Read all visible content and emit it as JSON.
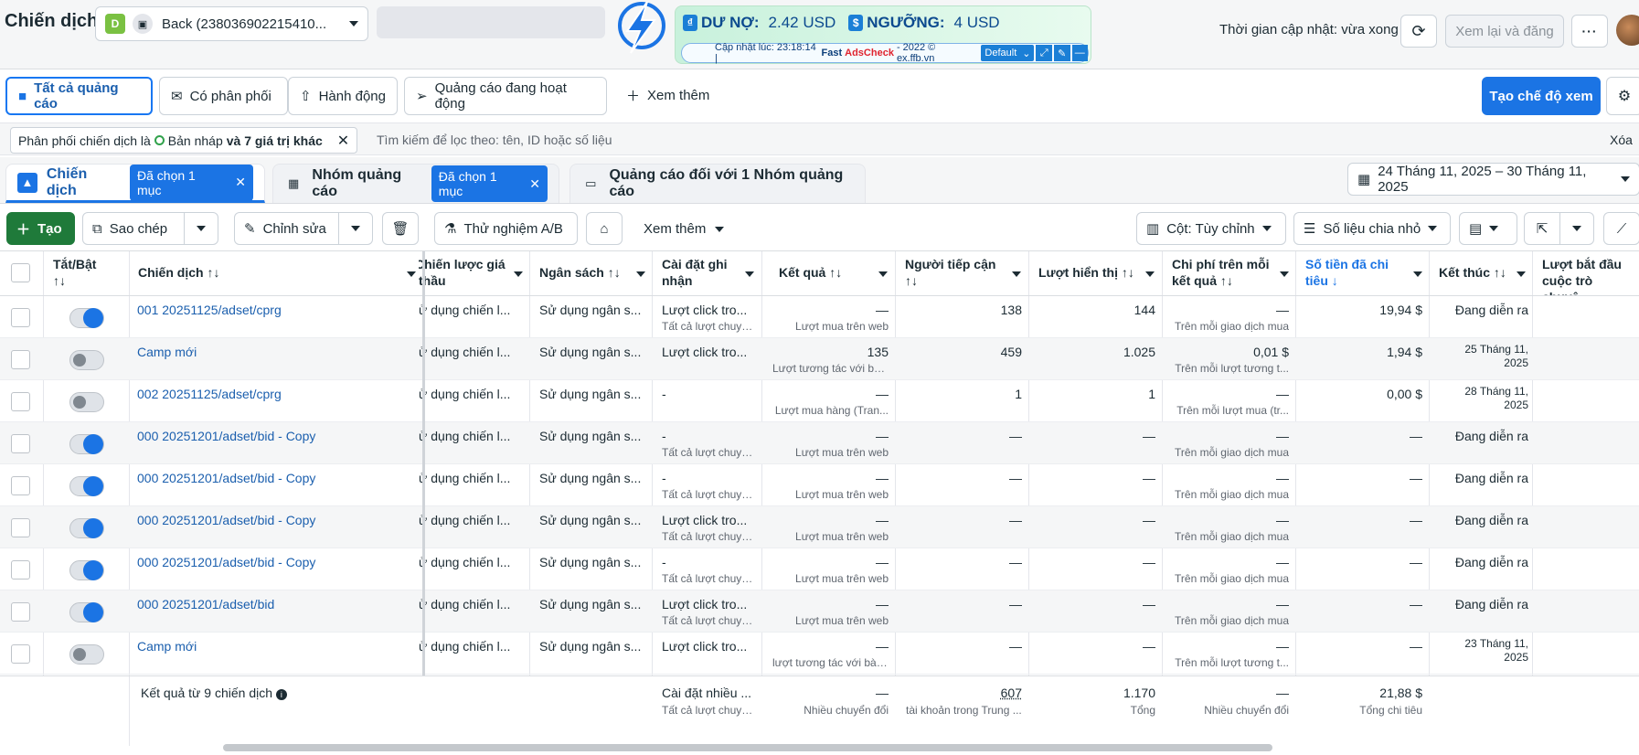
{
  "app_title": "Chiến dịch",
  "account": {
    "initial": "D",
    "name": "Back (238036902215410..."
  },
  "extension": {
    "debt_label": "DƯ NỢ:",
    "debt_value": "2.42 USD",
    "threshold_label": "NGƯỠNG:",
    "threshold_value": "4 USD",
    "update_prefix": "Cập nhật lúc: 23:18:14 |",
    "fast": "Fast",
    "brand": "AdsCheck",
    "suffix": "- 2022 © ex.ffb.vn",
    "profile": "Default"
  },
  "header": {
    "update_text": "Thời gian cập nhật: vừa xong",
    "review_label": "Xem lại và đăng"
  },
  "views": {
    "tabs": [
      "Tất cả quảng cáo",
      "Có phân phối",
      "Hành động",
      "Quảng cáo đang hoạt động"
    ],
    "more": "Xem thêm",
    "create_view": "Tạo chế độ xem"
  },
  "filter": {
    "chip_prefix": "Phân phối chiến dịch là",
    "chip_value": "Bản nháp",
    "chip_suffix": "và 7 giá trị khác",
    "search_placeholder": "Tìm kiếm để lọc theo: tên, ID hoặc số liệu",
    "clear": "Xóa"
  },
  "levels": {
    "campaign": "Chiến dịch",
    "adset": "Nhóm quảng cáo",
    "ad": "Quảng cáo đối với 1 Nhóm quảng cáo",
    "selected": "Đã chọn 1 mục",
    "date_range": "24 Tháng 11, 2025 – 30 Tháng 11, 2025"
  },
  "toolbar": {
    "create": "Tạo",
    "duplicate": "Sao chép",
    "edit": "Chỉnh sửa",
    "ab_test": "Thử nghiệm A/B",
    "more": "Xem thêm",
    "columns": "Cột: Tùy chỉnh",
    "breakdown": "Số liệu chia nhỏ"
  },
  "columns": {
    "toggle": "Tắt/Bật",
    "name": "Chiến dịch",
    "bid": "Chiến lược giá thầu",
    "budget": "Ngân sách",
    "attribution": "Cài đặt ghi nhận",
    "results": "Kết quả",
    "reach": "Người tiếp cận",
    "impressions": "Lượt hiển thị",
    "cpr": "Chi phí trên mỗi kết quả",
    "spent": "Số tiền đã chi tiêu",
    "ends": "Kết thúc",
    "starts": "Lượt bắt đầu cuộc trò chuyệ..."
  },
  "rows": [
    {
      "on": true,
      "name": "001 20251125/adset/cprg",
      "bid": "ử dụng chiến l...",
      "budget": "Sử dụng ngân s...",
      "attr": "Lượt click tro...",
      "attr_sub": "Tất cả lượt chuyể...",
      "result": "—",
      "result_sub": "Lượt mua trên web",
      "reach": "138",
      "impr": "144",
      "cpr": "—",
      "cpr_sub": "Trên mỗi giao dịch mua",
      "spent": "19,94 $",
      "ends": "Đang diễn ra",
      "ends_small": false
    },
    {
      "on": false,
      "name": "Camp mới",
      "bid": "ử dụng chiến l...",
      "budget": "Sử dụng ngân s...",
      "attr": "Lượt click tro...",
      "attr_sub": "",
      "result": "135",
      "result_sub": "Lượt tương tác với bài...",
      "reach": "459",
      "impr": "1.025",
      "cpr": "0,01 $",
      "cpr_sub": "Trên mỗi lượt tương t...",
      "spent": "1,94 $",
      "ends": "25 Tháng 11, 2025",
      "ends_small": true
    },
    {
      "on": false,
      "name": "002 20251125/adset/cprg",
      "bid": "ử dụng chiến l...",
      "budget": "Sử dụng ngân s...",
      "attr": "-",
      "attr_sub": "",
      "result": "—",
      "result_sub": "Lượt mua hàng (Tran...",
      "reach": "1",
      "impr": "1",
      "cpr": "—",
      "cpr_sub": "Trên mỗi lượt mua (tr...",
      "spent": "0,00 $",
      "ends": "28 Tháng 11, 2025",
      "ends_small": true
    },
    {
      "on": true,
      "name": "000 20251201/adset/bid - Copy",
      "bid": "ử dụng chiến l...",
      "budget": "Sử dụng ngân s...",
      "attr": "-",
      "attr_sub": "Tất cả lượt chuyể...",
      "result": "—",
      "result_sub": "Lượt mua trên web",
      "reach": "—",
      "impr": "—",
      "cpr": "—",
      "cpr_sub": "Trên mỗi giao dịch mua",
      "spent": "—",
      "ends": "Đang diễn ra",
      "ends_small": false
    },
    {
      "on": true,
      "name": "000 20251201/adset/bid - Copy",
      "bid": "ử dụng chiến l...",
      "budget": "Sử dụng ngân s...",
      "attr": "-",
      "attr_sub": "Tất cả lượt chuyể...",
      "result": "—",
      "result_sub": "Lượt mua trên web",
      "reach": "—",
      "impr": "—",
      "cpr": "—",
      "cpr_sub": "Trên mỗi giao dịch mua",
      "spent": "—",
      "ends": "Đang diễn ra",
      "ends_small": false
    },
    {
      "on": true,
      "name": "000 20251201/adset/bid - Copy",
      "bid": "ử dụng chiến l...",
      "budget": "Sử dụng ngân s...",
      "attr": "Lượt click tro...",
      "attr_sub": "Tất cả lượt chuyể...",
      "result": "—",
      "result_sub": "Lượt mua trên web",
      "reach": "—",
      "impr": "—",
      "cpr": "—",
      "cpr_sub": "Trên mỗi giao dịch mua",
      "spent": "—",
      "ends": "Đang diễn ra",
      "ends_small": false
    },
    {
      "on": true,
      "name": "000 20251201/adset/bid - Copy",
      "bid": "ử dụng chiến l...",
      "budget": "Sử dụng ngân s...",
      "attr": "-",
      "attr_sub": "Tất cả lượt chuyể...",
      "result": "—",
      "result_sub": "Lượt mua trên web",
      "reach": "—",
      "impr": "—",
      "cpr": "—",
      "cpr_sub": "Trên mỗi giao dịch mua",
      "spent": "—",
      "ends": "Đang diễn ra",
      "ends_small": false
    },
    {
      "on": true,
      "name": "000 20251201/adset/bid",
      "bid": "ử dụng chiến l...",
      "budget": "Sử dụng ngân s...",
      "attr": "Lượt click tro...",
      "attr_sub": "Tất cả lượt chuyể...",
      "result": "—",
      "result_sub": "Lượt mua trên web",
      "reach": "—",
      "impr": "—",
      "cpr": "—",
      "cpr_sub": "Trên mỗi giao dịch mua",
      "spent": "—",
      "ends": "Đang diễn ra",
      "ends_small": false
    },
    {
      "on": false,
      "name": "Camp mới",
      "bid": "ử dụng chiến l...",
      "budget": "Sử dụng ngân s...",
      "attr": "Lượt click tro...",
      "attr_sub": "",
      "result": "—",
      "result_sub": "lượt tương tác với bài ...",
      "reach": "—",
      "impr": "—",
      "cpr": "—",
      "cpr_sub": "Trên mỗi lượt tương t...",
      "spent": "—",
      "ends": "23 Tháng 11, 2025",
      "ends_small": true
    }
  ],
  "summary": {
    "label": "Kết quả từ 9 chiến dịch",
    "attr": "Cài đặt nhiều ...",
    "attr_sub": "Tất cả lượt chuyể...",
    "result": "—",
    "result_sub": "Nhiều chuyển đổi",
    "reach": "607",
    "reach_sub": "tài khoản trong Trung ...",
    "impr": "1.170",
    "impr_sub": "Tổng",
    "cpr": "—",
    "cpr_sub": "Nhiều chuyển đổi",
    "spent": "21,88 $",
    "spent_sub": "Tổng chi tiêu"
  }
}
